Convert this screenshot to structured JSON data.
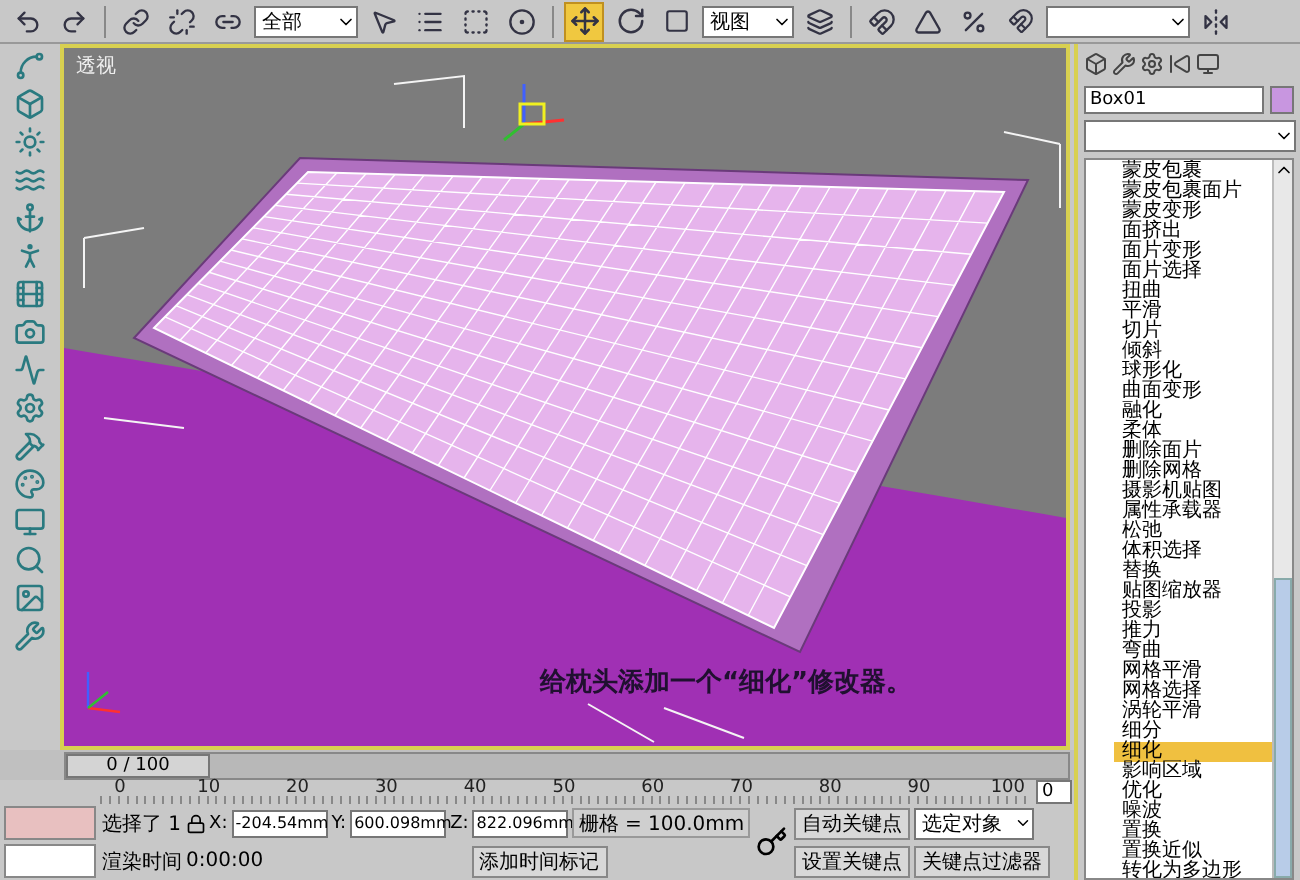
{
  "toolbar": {
    "selection_filter": "全部",
    "reference_coord": "视图",
    "transform_tools": [
      {
        "kind": "move",
        "selected": true
      },
      {
        "kind": "rotate",
        "selected": false
      },
      {
        "kind": "scale",
        "selected": false
      }
    ]
  },
  "viewport": {
    "label": "透视",
    "caption": "给枕头添加一个“细化”修改器。"
  },
  "time_slider": {
    "label": "0 / 100",
    "level": 0
  },
  "track_ticks": [
    "0",
    "10",
    "20",
    "30",
    "40",
    "50",
    "60",
    "70",
    "80",
    "90",
    "100"
  ],
  "status": {
    "selection": "选择了 1",
    "x_label": "X:",
    "x": "-204.54mm",
    "y_label": "Y:",
    "y": "600.098mm",
    "z_label": "Z:",
    "z": "822.096mm",
    "grid": "栅格 = 100.0mm",
    "render_time_label": "渲染时间",
    "render_time": "0:00:00",
    "add_time_tag": "添加时间标记",
    "auto_key": "自动关键点",
    "set_key": "设置关键点",
    "key_filter_mode": "选定对象",
    "key_filters": "关键点过滤器",
    "frame": "0"
  },
  "modify_panel": {
    "object_name": "Box01",
    "modifier_list": [
      {
        "label": "蒙皮包裹",
        "selected": false
      },
      {
        "label": "蒙皮包裹面片",
        "selected": false
      },
      {
        "label": "蒙皮变形",
        "selected": false
      },
      {
        "label": "面挤出",
        "selected": false
      },
      {
        "label": "面片变形",
        "selected": false
      },
      {
        "label": "面片选择",
        "selected": false
      },
      {
        "label": "扭曲",
        "selected": false
      },
      {
        "label": "平滑",
        "selected": false
      },
      {
        "label": "切片",
        "selected": false
      },
      {
        "label": "倾斜",
        "selected": false
      },
      {
        "label": "球形化",
        "selected": false
      },
      {
        "label": "曲面变形",
        "selected": false
      },
      {
        "label": "融化",
        "selected": false
      },
      {
        "label": "柔体",
        "selected": false
      },
      {
        "label": "删除面片",
        "selected": false
      },
      {
        "label": "删除网格",
        "selected": false
      },
      {
        "label": "摄影机贴图",
        "selected": false
      },
      {
        "label": "属性承载器",
        "selected": false
      },
      {
        "label": "松弛",
        "selected": false
      },
      {
        "label": "体积选择",
        "selected": false
      },
      {
        "label": "替换",
        "selected": false
      },
      {
        "label": "贴图缩放器",
        "selected": false
      },
      {
        "label": "投影",
        "selected": false
      },
      {
        "label": "推力",
        "selected": false
      },
      {
        "label": "弯曲",
        "selected": false
      },
      {
        "label": "网格平滑",
        "selected": false
      },
      {
        "label": "网格选择",
        "selected": false
      },
      {
        "label": "涡轮平滑",
        "selected": false
      },
      {
        "label": "细分",
        "selected": false
      },
      {
        "label": "细化",
        "selected": true
      },
      {
        "label": "影响区域",
        "selected": false
      },
      {
        "label": "优化",
        "selected": false
      },
      {
        "label": "噪波",
        "selected": false
      },
      {
        "label": "置换",
        "selected": false
      },
      {
        "label": "置换近似",
        "selected": false
      },
      {
        "label": "转化为多边形",
        "selected": false
      }
    ]
  }
}
